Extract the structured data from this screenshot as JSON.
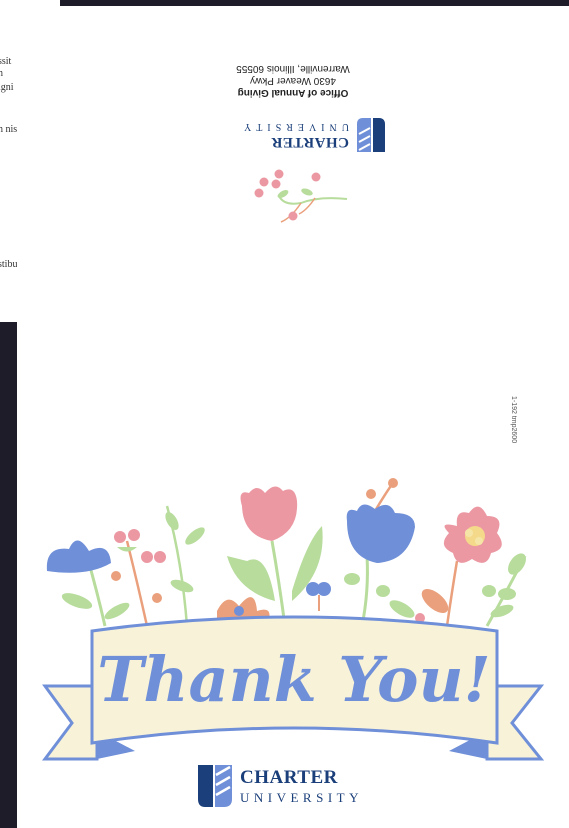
{
  "background_document": {
    "fragments": [
      "ssit",
      "n",
      "igni",
      "n nis",
      "stibu"
    ]
  },
  "return_address": {
    "office": "Office of Annual Giving",
    "street": "4630 Weaver Pkwy",
    "city": "Warrenville, Illinois 60555"
  },
  "logo": {
    "name": "CHARTER",
    "subtitle": "UNIVERSITY"
  },
  "print_code": "1-192 tmp2600",
  "banner": {
    "text": "Thank You!"
  },
  "colors": {
    "navy": "#1b3f7a",
    "banner_fill": "#f8f2d8",
    "banner_blue": "#6f8fd8",
    "pink": "#eb98a3",
    "leaf": "#b7dc9c",
    "orange": "#eaa07c"
  }
}
